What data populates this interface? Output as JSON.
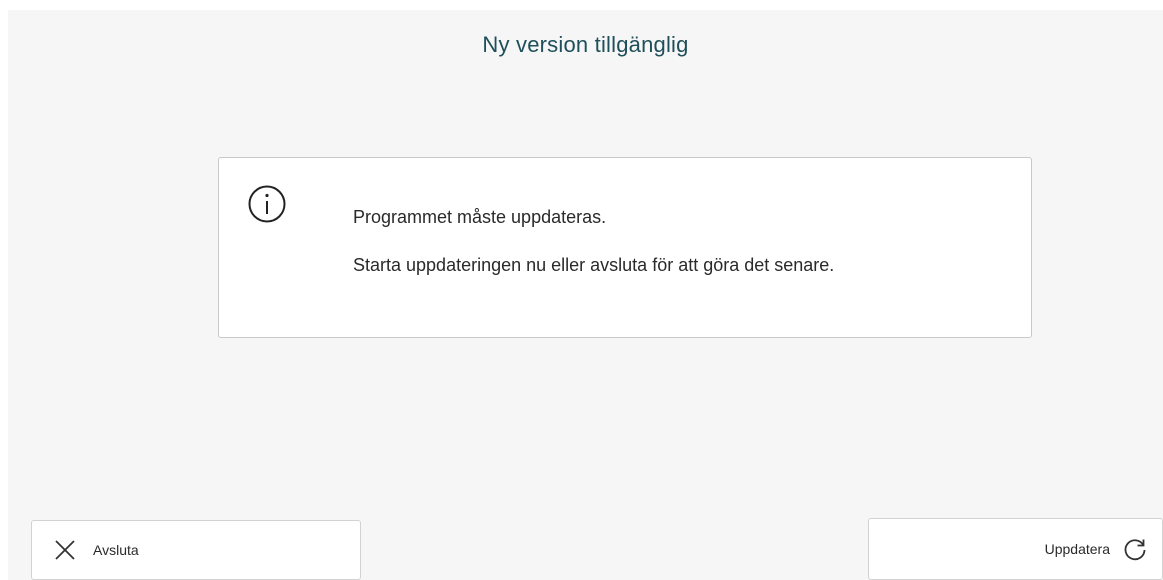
{
  "dialog": {
    "title": "Ny version tillgänglig",
    "info_icon": "info-circle-icon",
    "message_line_1": "Programmet måste uppdateras.",
    "message_line_2": "Starta uppdateringen nu eller avsluta för att göra det senare."
  },
  "footer": {
    "quit_label": "Avsluta",
    "quit_icon": "close-icon",
    "update_label": "Uppdatera",
    "update_icon": "refresh-icon"
  },
  "colors": {
    "background": "#f6f6f6",
    "title": "#1f4f5a",
    "text": "#2a2a2a",
    "border": "#c9c9c9"
  }
}
